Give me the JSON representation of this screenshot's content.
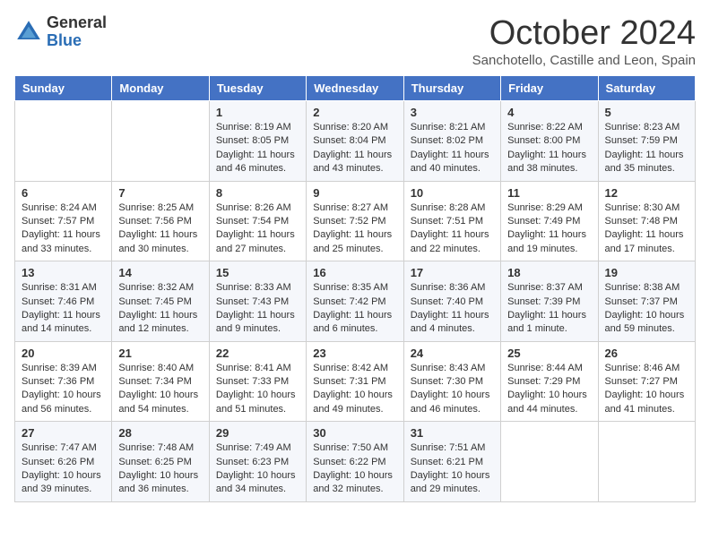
{
  "header": {
    "logo_general": "General",
    "logo_blue": "Blue",
    "month_title": "October 2024",
    "location": "Sanchotello, Castille and Leon, Spain"
  },
  "days_of_week": [
    "Sunday",
    "Monday",
    "Tuesday",
    "Wednesday",
    "Thursday",
    "Friday",
    "Saturday"
  ],
  "weeks": [
    [
      {
        "day": "",
        "sunrise": "",
        "sunset": "",
        "daylight": ""
      },
      {
        "day": "",
        "sunrise": "",
        "sunset": "",
        "daylight": ""
      },
      {
        "day": "1",
        "sunrise": "Sunrise: 8:19 AM",
        "sunset": "Sunset: 8:05 PM",
        "daylight": "Daylight: 11 hours and 46 minutes."
      },
      {
        "day": "2",
        "sunrise": "Sunrise: 8:20 AM",
        "sunset": "Sunset: 8:04 PM",
        "daylight": "Daylight: 11 hours and 43 minutes."
      },
      {
        "day": "3",
        "sunrise": "Sunrise: 8:21 AM",
        "sunset": "Sunset: 8:02 PM",
        "daylight": "Daylight: 11 hours and 40 minutes."
      },
      {
        "day": "4",
        "sunrise": "Sunrise: 8:22 AM",
        "sunset": "Sunset: 8:00 PM",
        "daylight": "Daylight: 11 hours and 38 minutes."
      },
      {
        "day": "5",
        "sunrise": "Sunrise: 8:23 AM",
        "sunset": "Sunset: 7:59 PM",
        "daylight": "Daylight: 11 hours and 35 minutes."
      }
    ],
    [
      {
        "day": "6",
        "sunrise": "Sunrise: 8:24 AM",
        "sunset": "Sunset: 7:57 PM",
        "daylight": "Daylight: 11 hours and 33 minutes."
      },
      {
        "day": "7",
        "sunrise": "Sunrise: 8:25 AM",
        "sunset": "Sunset: 7:56 PM",
        "daylight": "Daylight: 11 hours and 30 minutes."
      },
      {
        "day": "8",
        "sunrise": "Sunrise: 8:26 AM",
        "sunset": "Sunset: 7:54 PM",
        "daylight": "Daylight: 11 hours and 27 minutes."
      },
      {
        "day": "9",
        "sunrise": "Sunrise: 8:27 AM",
        "sunset": "Sunset: 7:52 PM",
        "daylight": "Daylight: 11 hours and 25 minutes."
      },
      {
        "day": "10",
        "sunrise": "Sunrise: 8:28 AM",
        "sunset": "Sunset: 7:51 PM",
        "daylight": "Daylight: 11 hours and 22 minutes."
      },
      {
        "day": "11",
        "sunrise": "Sunrise: 8:29 AM",
        "sunset": "Sunset: 7:49 PM",
        "daylight": "Daylight: 11 hours and 19 minutes."
      },
      {
        "day": "12",
        "sunrise": "Sunrise: 8:30 AM",
        "sunset": "Sunset: 7:48 PM",
        "daylight": "Daylight: 11 hours and 17 minutes."
      }
    ],
    [
      {
        "day": "13",
        "sunrise": "Sunrise: 8:31 AM",
        "sunset": "Sunset: 7:46 PM",
        "daylight": "Daylight: 11 hours and 14 minutes."
      },
      {
        "day": "14",
        "sunrise": "Sunrise: 8:32 AM",
        "sunset": "Sunset: 7:45 PM",
        "daylight": "Daylight: 11 hours and 12 minutes."
      },
      {
        "day": "15",
        "sunrise": "Sunrise: 8:33 AM",
        "sunset": "Sunset: 7:43 PM",
        "daylight": "Daylight: 11 hours and 9 minutes."
      },
      {
        "day": "16",
        "sunrise": "Sunrise: 8:35 AM",
        "sunset": "Sunset: 7:42 PM",
        "daylight": "Daylight: 11 hours and 6 minutes."
      },
      {
        "day": "17",
        "sunrise": "Sunrise: 8:36 AM",
        "sunset": "Sunset: 7:40 PM",
        "daylight": "Daylight: 11 hours and 4 minutes."
      },
      {
        "day": "18",
        "sunrise": "Sunrise: 8:37 AM",
        "sunset": "Sunset: 7:39 PM",
        "daylight": "Daylight: 11 hours and 1 minute."
      },
      {
        "day": "19",
        "sunrise": "Sunrise: 8:38 AM",
        "sunset": "Sunset: 7:37 PM",
        "daylight": "Daylight: 10 hours and 59 minutes."
      }
    ],
    [
      {
        "day": "20",
        "sunrise": "Sunrise: 8:39 AM",
        "sunset": "Sunset: 7:36 PM",
        "daylight": "Daylight: 10 hours and 56 minutes."
      },
      {
        "day": "21",
        "sunrise": "Sunrise: 8:40 AM",
        "sunset": "Sunset: 7:34 PM",
        "daylight": "Daylight: 10 hours and 54 minutes."
      },
      {
        "day": "22",
        "sunrise": "Sunrise: 8:41 AM",
        "sunset": "Sunset: 7:33 PM",
        "daylight": "Daylight: 10 hours and 51 minutes."
      },
      {
        "day": "23",
        "sunrise": "Sunrise: 8:42 AM",
        "sunset": "Sunset: 7:31 PM",
        "daylight": "Daylight: 10 hours and 49 minutes."
      },
      {
        "day": "24",
        "sunrise": "Sunrise: 8:43 AM",
        "sunset": "Sunset: 7:30 PM",
        "daylight": "Daylight: 10 hours and 46 minutes."
      },
      {
        "day": "25",
        "sunrise": "Sunrise: 8:44 AM",
        "sunset": "Sunset: 7:29 PM",
        "daylight": "Daylight: 10 hours and 44 minutes."
      },
      {
        "day": "26",
        "sunrise": "Sunrise: 8:46 AM",
        "sunset": "Sunset: 7:27 PM",
        "daylight": "Daylight: 10 hours and 41 minutes."
      }
    ],
    [
      {
        "day": "27",
        "sunrise": "Sunrise: 7:47 AM",
        "sunset": "Sunset: 6:26 PM",
        "daylight": "Daylight: 10 hours and 39 minutes."
      },
      {
        "day": "28",
        "sunrise": "Sunrise: 7:48 AM",
        "sunset": "Sunset: 6:25 PM",
        "daylight": "Daylight: 10 hours and 36 minutes."
      },
      {
        "day": "29",
        "sunrise": "Sunrise: 7:49 AM",
        "sunset": "Sunset: 6:23 PM",
        "daylight": "Daylight: 10 hours and 34 minutes."
      },
      {
        "day": "30",
        "sunrise": "Sunrise: 7:50 AM",
        "sunset": "Sunset: 6:22 PM",
        "daylight": "Daylight: 10 hours and 32 minutes."
      },
      {
        "day": "31",
        "sunrise": "Sunrise: 7:51 AM",
        "sunset": "Sunset: 6:21 PM",
        "daylight": "Daylight: 10 hours and 29 minutes."
      },
      {
        "day": "",
        "sunrise": "",
        "sunset": "",
        "daylight": ""
      },
      {
        "day": "",
        "sunrise": "",
        "sunset": "",
        "daylight": ""
      }
    ]
  ]
}
